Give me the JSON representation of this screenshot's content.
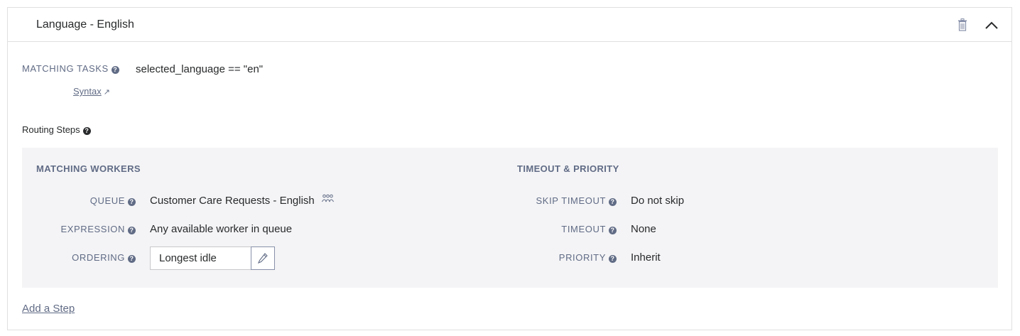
{
  "filter": {
    "title": "Language - English",
    "matching_tasks_label": "MATCHING TASKS",
    "matching_tasks_expression": "selected_language == \"en\"",
    "syntax_link": "Syntax",
    "routing_steps_label": "Routing Steps",
    "add_step_label": "Add a Step"
  },
  "step": {
    "matching_workers_heading": "MATCHING WORKERS",
    "timeout_priority_heading": "TIMEOUT & PRIORITY",
    "queue_label": "QUEUE",
    "queue_value": "Customer Care Requests - English",
    "expression_label": "EXPRESSION",
    "expression_value": "Any available worker in queue",
    "ordering_label": "ORDERING",
    "ordering_value": "Longest idle",
    "skip_timeout_label": "SKIP TIMEOUT",
    "skip_timeout_value": "Do not skip",
    "timeout_label": "TIMEOUT",
    "timeout_value": "None",
    "priority_label": "PRIORITY",
    "priority_value": "Inherit"
  },
  "icons": {
    "help": "question-circle-icon",
    "delete": "trash-icon",
    "collapse": "chevron-up-icon",
    "external": "external-link-icon",
    "queue": "people-icon",
    "edit": "pencil-icon"
  },
  "colors": {
    "text": "#282a2b",
    "muted": "#606b85",
    "step_background": "#f4f4f6",
    "border": "#e0e0e0"
  }
}
